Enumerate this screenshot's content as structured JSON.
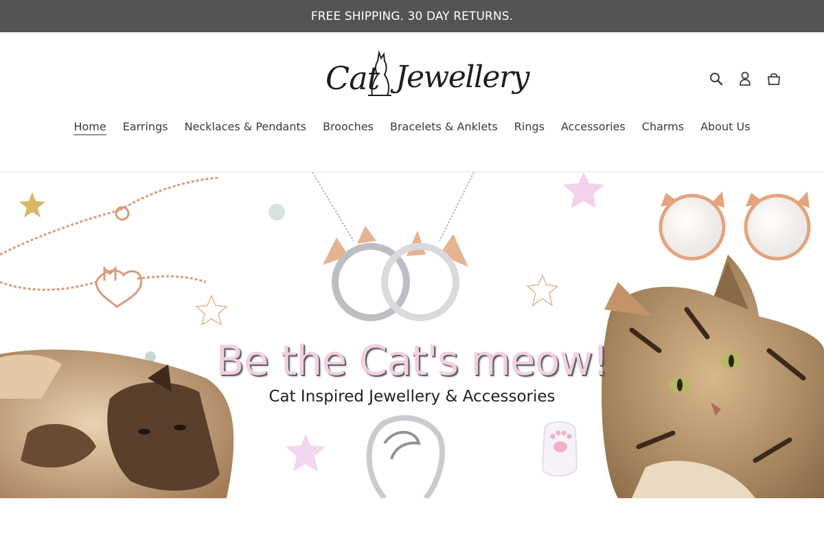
{
  "announcement": {
    "text": "FREE SHIPPING. 30 DAY RETURNS."
  },
  "logo": {
    "word1": "Cat",
    "word2": "Jewellery"
  },
  "header_icons": [
    {
      "name": "search-icon",
      "label": "Search"
    },
    {
      "name": "account-icon",
      "label": "Log in"
    },
    {
      "name": "cart-icon",
      "label": "Cart"
    }
  ],
  "nav": {
    "items": [
      {
        "label": "Home",
        "active": true
      },
      {
        "label": "Earrings"
      },
      {
        "label": "Necklaces & Pendants"
      },
      {
        "label": "Brooches"
      },
      {
        "label": "Bracelets & Anklets"
      },
      {
        "label": "Rings"
      },
      {
        "label": "Accessories"
      },
      {
        "label": "Charms"
      },
      {
        "label": "About Us"
      }
    ]
  },
  "hero": {
    "title": "Be the Cat's meow!",
    "subtitle": "Cat Inspired Jewellery & Accessories"
  },
  "colors": {
    "announcement_bg": "#555354",
    "title_pink": "#f3cfe2",
    "rose_gold": "#d99a7a",
    "silver": "#c9cbcf"
  }
}
